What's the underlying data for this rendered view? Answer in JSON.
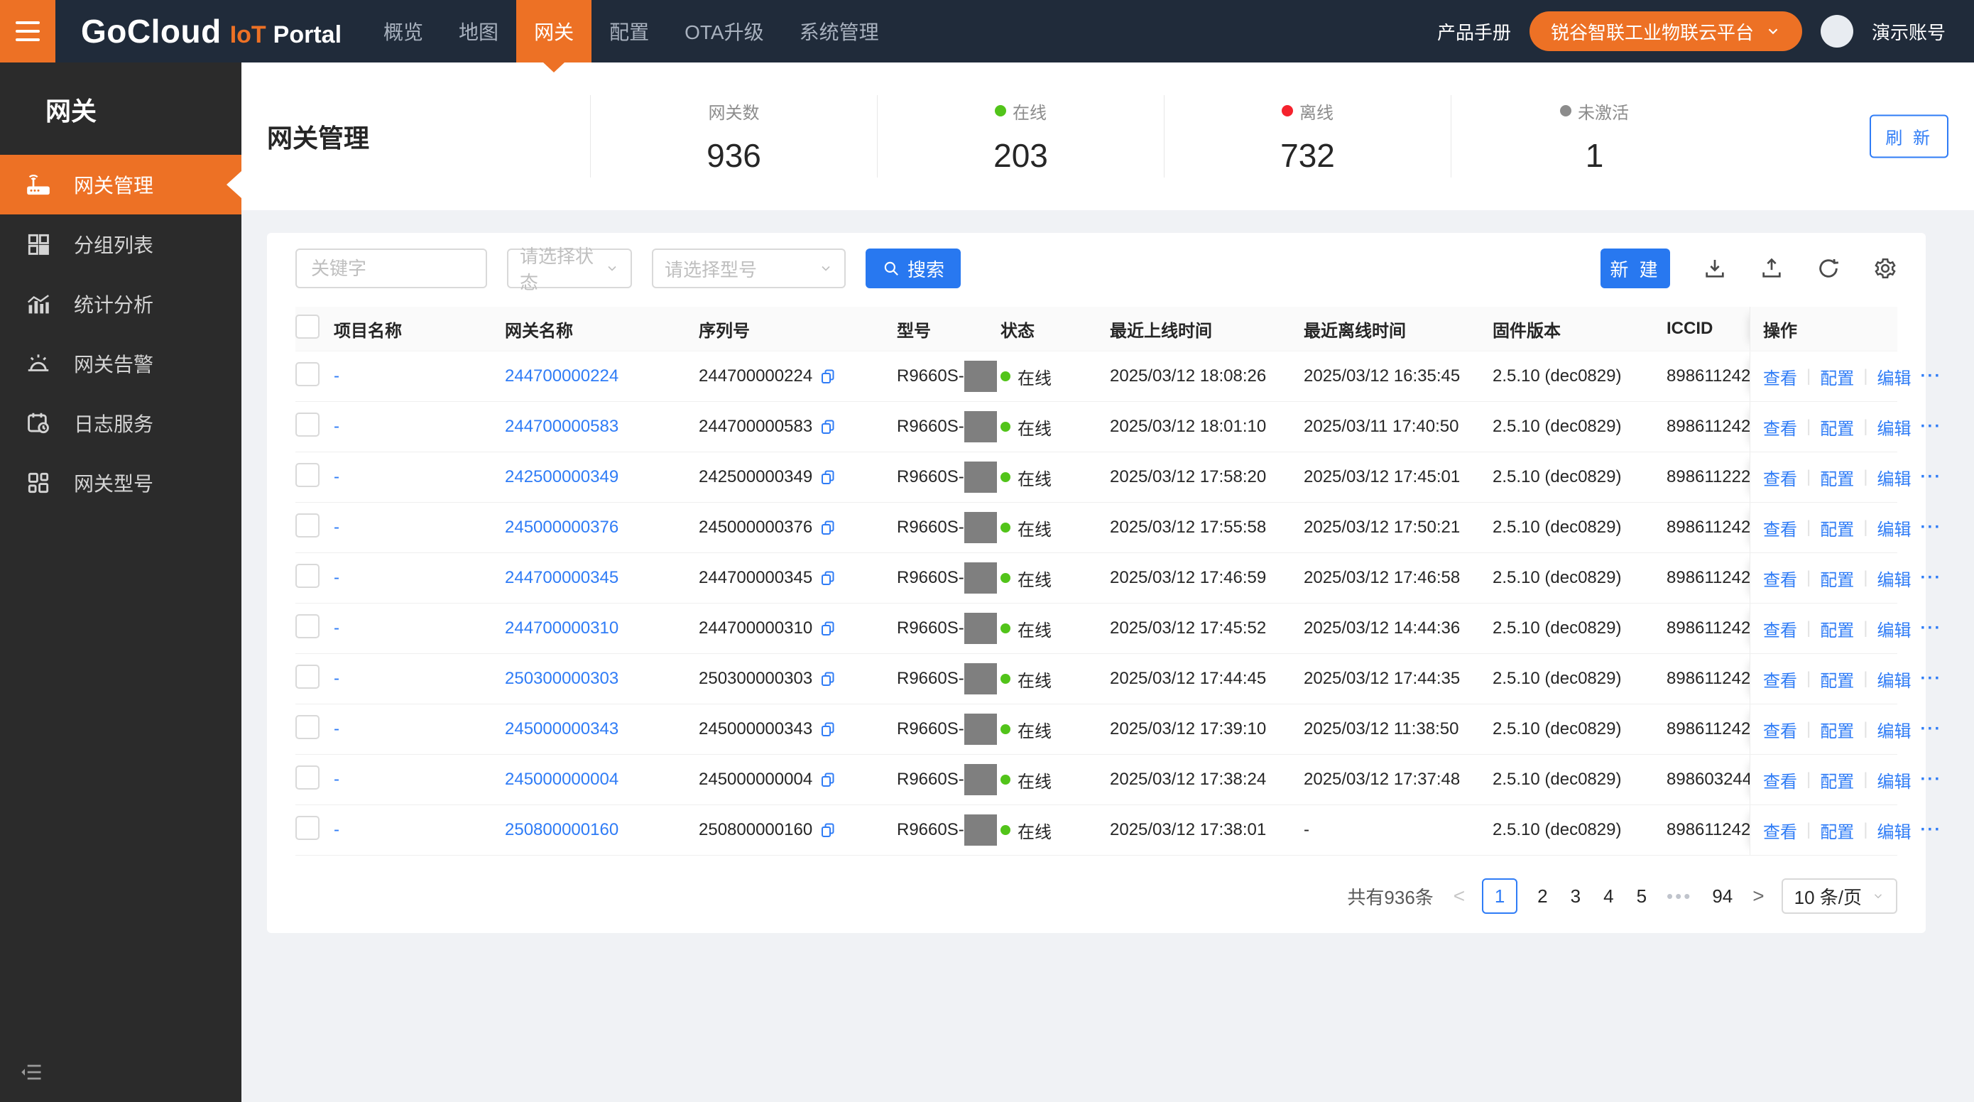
{
  "colors": {
    "accent_orange": "#ed7125",
    "primary_blue": "#2878f0",
    "link_blue": "#2f7cf6",
    "online_green": "#52c41a",
    "offline_red": "#f5222d",
    "inactive_gray": "#8c8c8c",
    "navbar_bg": "#202b3a",
    "sidebar_bg": "#2b2b2b"
  },
  "navbar": {
    "logo": {
      "brand": "GoCloud",
      "iot": "IoT",
      "portal": "Portal"
    },
    "menu": [
      {
        "label": "概览"
      },
      {
        "label": "地图"
      },
      {
        "label": "网关",
        "active": true
      },
      {
        "label": "配置"
      },
      {
        "label": "OTA升级"
      },
      {
        "label": "系统管理"
      }
    ],
    "manual": "产品手册",
    "tenant": "锐谷智联工业物联云平台",
    "account": "演示账号"
  },
  "sidebar": {
    "title": "网关",
    "items": [
      {
        "label": "网关管理",
        "active": true
      },
      {
        "label": "分组列表"
      },
      {
        "label": "统计分析"
      },
      {
        "label": "网关告警"
      },
      {
        "label": "日志服务"
      },
      {
        "label": "网关型号"
      }
    ]
  },
  "page": {
    "title": "网关管理",
    "refresh_label": "刷 新",
    "stats": [
      {
        "label": "网关数",
        "value": "936",
        "dot": ""
      },
      {
        "label": "在线",
        "value": "203",
        "dot": "#52c41a"
      },
      {
        "label": "离线",
        "value": "732",
        "dot": "#f5222d"
      },
      {
        "label": "未激活",
        "value": "1",
        "dot": "#8c8c8c"
      }
    ]
  },
  "filters": {
    "keyword_placeholder": "关键字",
    "status_placeholder": "请选择状态",
    "model_placeholder": "请选择型号",
    "search_label": "搜索"
  },
  "toolbar": {
    "create_label": "新 建"
  },
  "table": {
    "columns": [
      "项目名称",
      "网关名称",
      "序列号",
      "型号",
      "状态",
      "最近上线时间",
      "最近离线时间",
      "固件版本",
      "ICCID",
      "操作"
    ],
    "actions": {
      "view": "查看",
      "config": "配置",
      "edit": "编辑",
      "more": "···"
    },
    "rows": [
      {
        "project": "-",
        "name": "244700000224",
        "serial": "244700000224",
        "model": "R9660S-",
        "status": "在线",
        "online": "2025/03/12 18:08:26",
        "offline": "2025/03/12 16:35:45",
        "firmware": "2.5.10 (dec0829)",
        "iccid": "898611242"
      },
      {
        "project": "-",
        "name": "244700000583",
        "serial": "244700000583",
        "model": "R9660S-",
        "status": "在线",
        "online": "2025/03/12 18:01:10",
        "offline": "2025/03/11 17:40:50",
        "firmware": "2.5.10 (dec0829)",
        "iccid": "898611242"
      },
      {
        "project": "-",
        "name": "242500000349",
        "serial": "242500000349",
        "model": "R9660S-",
        "status": "在线",
        "online": "2025/03/12 17:58:20",
        "offline": "2025/03/12 17:45:01",
        "firmware": "2.5.10 (dec0829)",
        "iccid": "898611222"
      },
      {
        "project": "-",
        "name": "245000000376",
        "serial": "245000000376",
        "model": "R9660S-",
        "status": "在线",
        "online": "2025/03/12 17:55:58",
        "offline": "2025/03/12 17:50:21",
        "firmware": "2.5.10 (dec0829)",
        "iccid": "898611242"
      },
      {
        "project": "-",
        "name": "244700000345",
        "serial": "244700000345",
        "model": "R9660S-",
        "status": "在线",
        "online": "2025/03/12 17:46:59",
        "offline": "2025/03/12 17:46:58",
        "firmware": "2.5.10 (dec0829)",
        "iccid": "898611242"
      },
      {
        "project": "-",
        "name": "244700000310",
        "serial": "244700000310",
        "model": "R9660S-",
        "status": "在线",
        "online": "2025/03/12 17:45:52",
        "offline": "2025/03/12 14:44:36",
        "firmware": "2.5.10 (dec0829)",
        "iccid": "898611242"
      },
      {
        "project": "-",
        "name": "250300000303",
        "serial": "250300000303",
        "model": "R9660S-",
        "status": "在线",
        "online": "2025/03/12 17:44:45",
        "offline": "2025/03/12 17:44:35",
        "firmware": "2.5.10 (dec0829)",
        "iccid": "898611242"
      },
      {
        "project": "-",
        "name": "245000000343",
        "serial": "245000000343",
        "model": "R9660S-",
        "status": "在线",
        "online": "2025/03/12 17:39:10",
        "offline": "2025/03/12 11:38:50",
        "firmware": "2.5.10 (dec0829)",
        "iccid": "898611242"
      },
      {
        "project": "-",
        "name": "245000000004",
        "serial": "245000000004",
        "model": "R9660S-",
        "status": "在线",
        "online": "2025/03/12 17:38:24",
        "offline": "2025/03/12 17:37:48",
        "firmware": "2.5.10 (dec0829)",
        "iccid": "898603244"
      },
      {
        "project": "-",
        "name": "250800000160",
        "serial": "250800000160",
        "model": "R9660S-",
        "status": "在线",
        "online": "2025/03/12 17:38:01",
        "offline": "-",
        "firmware": "2.5.10 (dec0829)",
        "iccid": "898611242"
      }
    ]
  },
  "pagination": {
    "total": "共有936条",
    "prev": "<",
    "next": ">",
    "pages": [
      "1",
      "2",
      "3",
      "4",
      "5"
    ],
    "ellipsis": "•••",
    "last_page": "94",
    "page_size": "10 条/页"
  }
}
